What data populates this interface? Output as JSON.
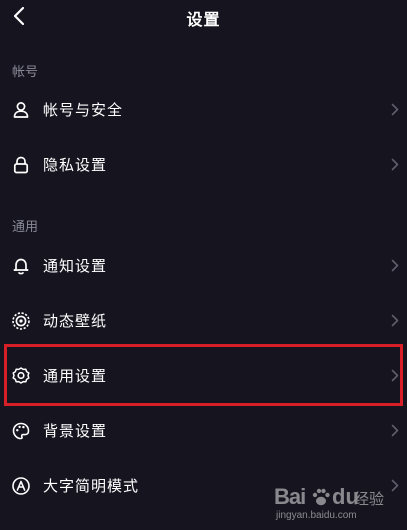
{
  "header": {
    "title": "设置",
    "back_icon": "chevron-left-icon"
  },
  "sections": [
    {
      "title": "帐号",
      "items": [
        {
          "label": "帐号与安全",
          "icon": "user-icon"
        },
        {
          "label": "隐私设置",
          "icon": "lock-icon"
        }
      ]
    },
    {
      "title": "通用",
      "items": [
        {
          "label": "通知设置",
          "icon": "bell-icon"
        },
        {
          "label": "动态壁纸",
          "icon": "dynamic-wallpaper-icon"
        },
        {
          "label": "通用设置",
          "icon": "gear-icon"
        },
        {
          "label": "背景设置",
          "icon": "palette-icon"
        },
        {
          "label": "大字简明模式",
          "icon": "large-text-icon"
        }
      ]
    }
  ],
  "highlight": {
    "target": "通用设置",
    "color": "#d61f26"
  },
  "watermark": {
    "brand": "Bai",
    "brand_cn": "经验",
    "url": "jingyan.baidu.com"
  },
  "colors": {
    "background": "#15141f",
    "text": "#ffffff",
    "section_header": "#8a8a97",
    "chevron": "#5f5e6b"
  }
}
